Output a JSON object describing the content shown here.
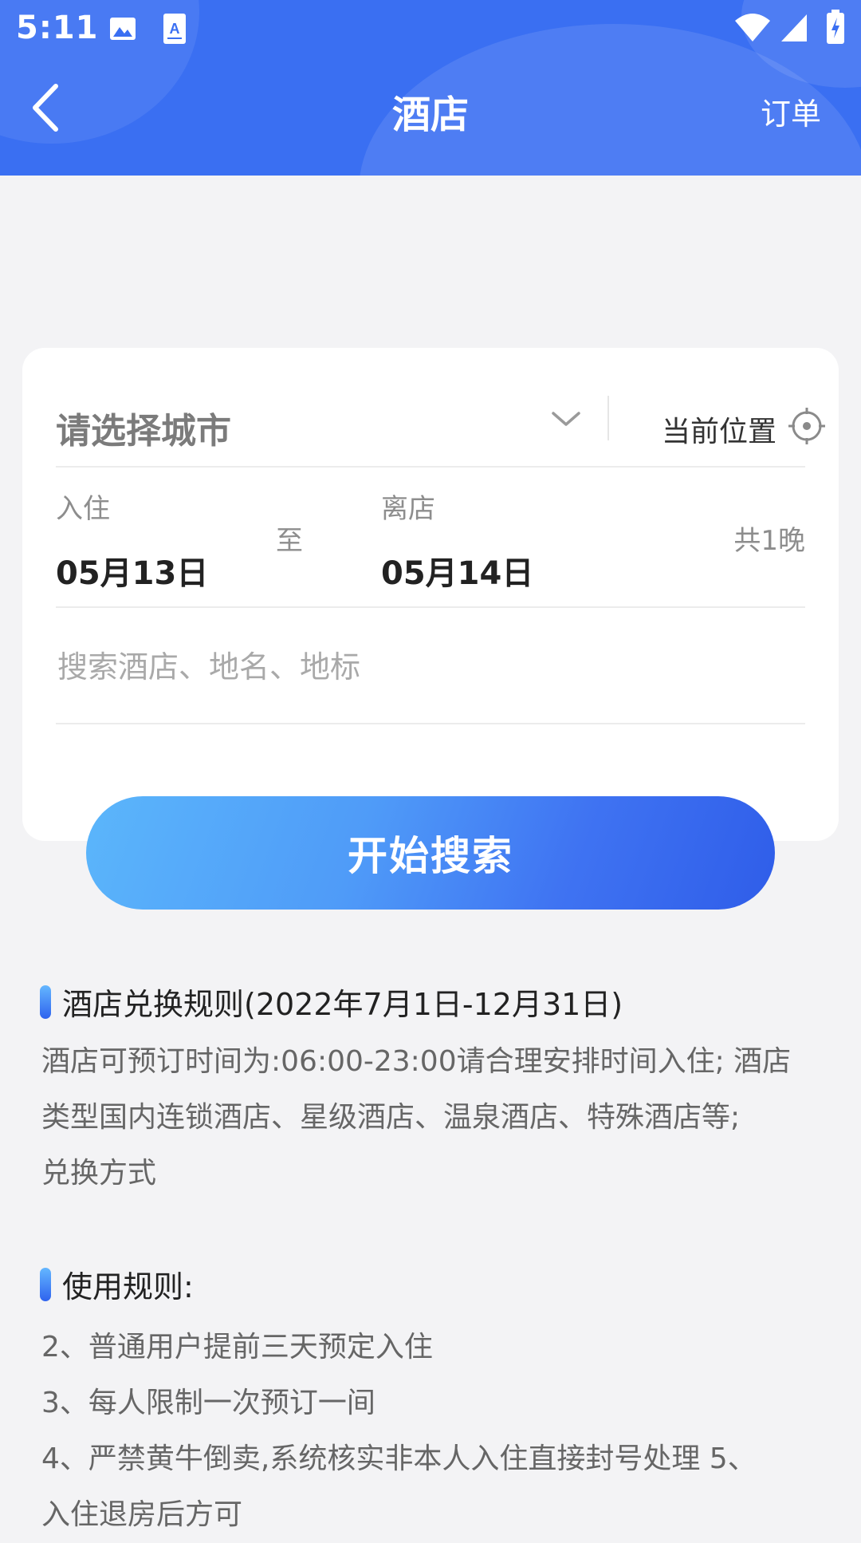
{
  "status_bar": {
    "time": "5:11"
  },
  "nav": {
    "title": "酒店",
    "right_action": "订单"
  },
  "search_card": {
    "city_placeholder": "请选择城市",
    "current_location": "当前位置",
    "checkin_label": "入住",
    "checkin_date": "05月13日",
    "to_label": "至",
    "checkout_label": "离店",
    "checkout_date": "05月14日",
    "nights": "共1晚",
    "search_placeholder": "搜索酒店、地名、地标"
  },
  "search_button": "开始搜索",
  "rules": {
    "exchange_title": "酒店兑换规则(2022年7月1日-12月31日)",
    "exchange_lines": [
      "酒店可预订时间为:06:00-23:00请合理安排时间入住; 酒店",
      "类型国内连锁酒店、星级酒店、温泉酒店、特殊酒店等;",
      "兑换方式"
    ],
    "usage_title": "使用规则:",
    "usage_lines": [
      "2、普通用户提前三天预定入住",
      "3、每人限制一次预订一间",
      "4、严禁黄牛倒卖,系统核实非本人入住直接封号处理 5、",
      "入住退房后方可"
    ]
  },
  "colors": {
    "header_blue": "#3a6ff2",
    "button_gradient_start": "#5bb6fb",
    "button_gradient_end": "#2f5de9"
  },
  "icons": [
    "back-arrow-icon",
    "image-icon",
    "text-scan-icon",
    "wifi-icon",
    "signal-icon",
    "battery-icon",
    "chevron-down-icon",
    "locate-crosshair-icon"
  ]
}
